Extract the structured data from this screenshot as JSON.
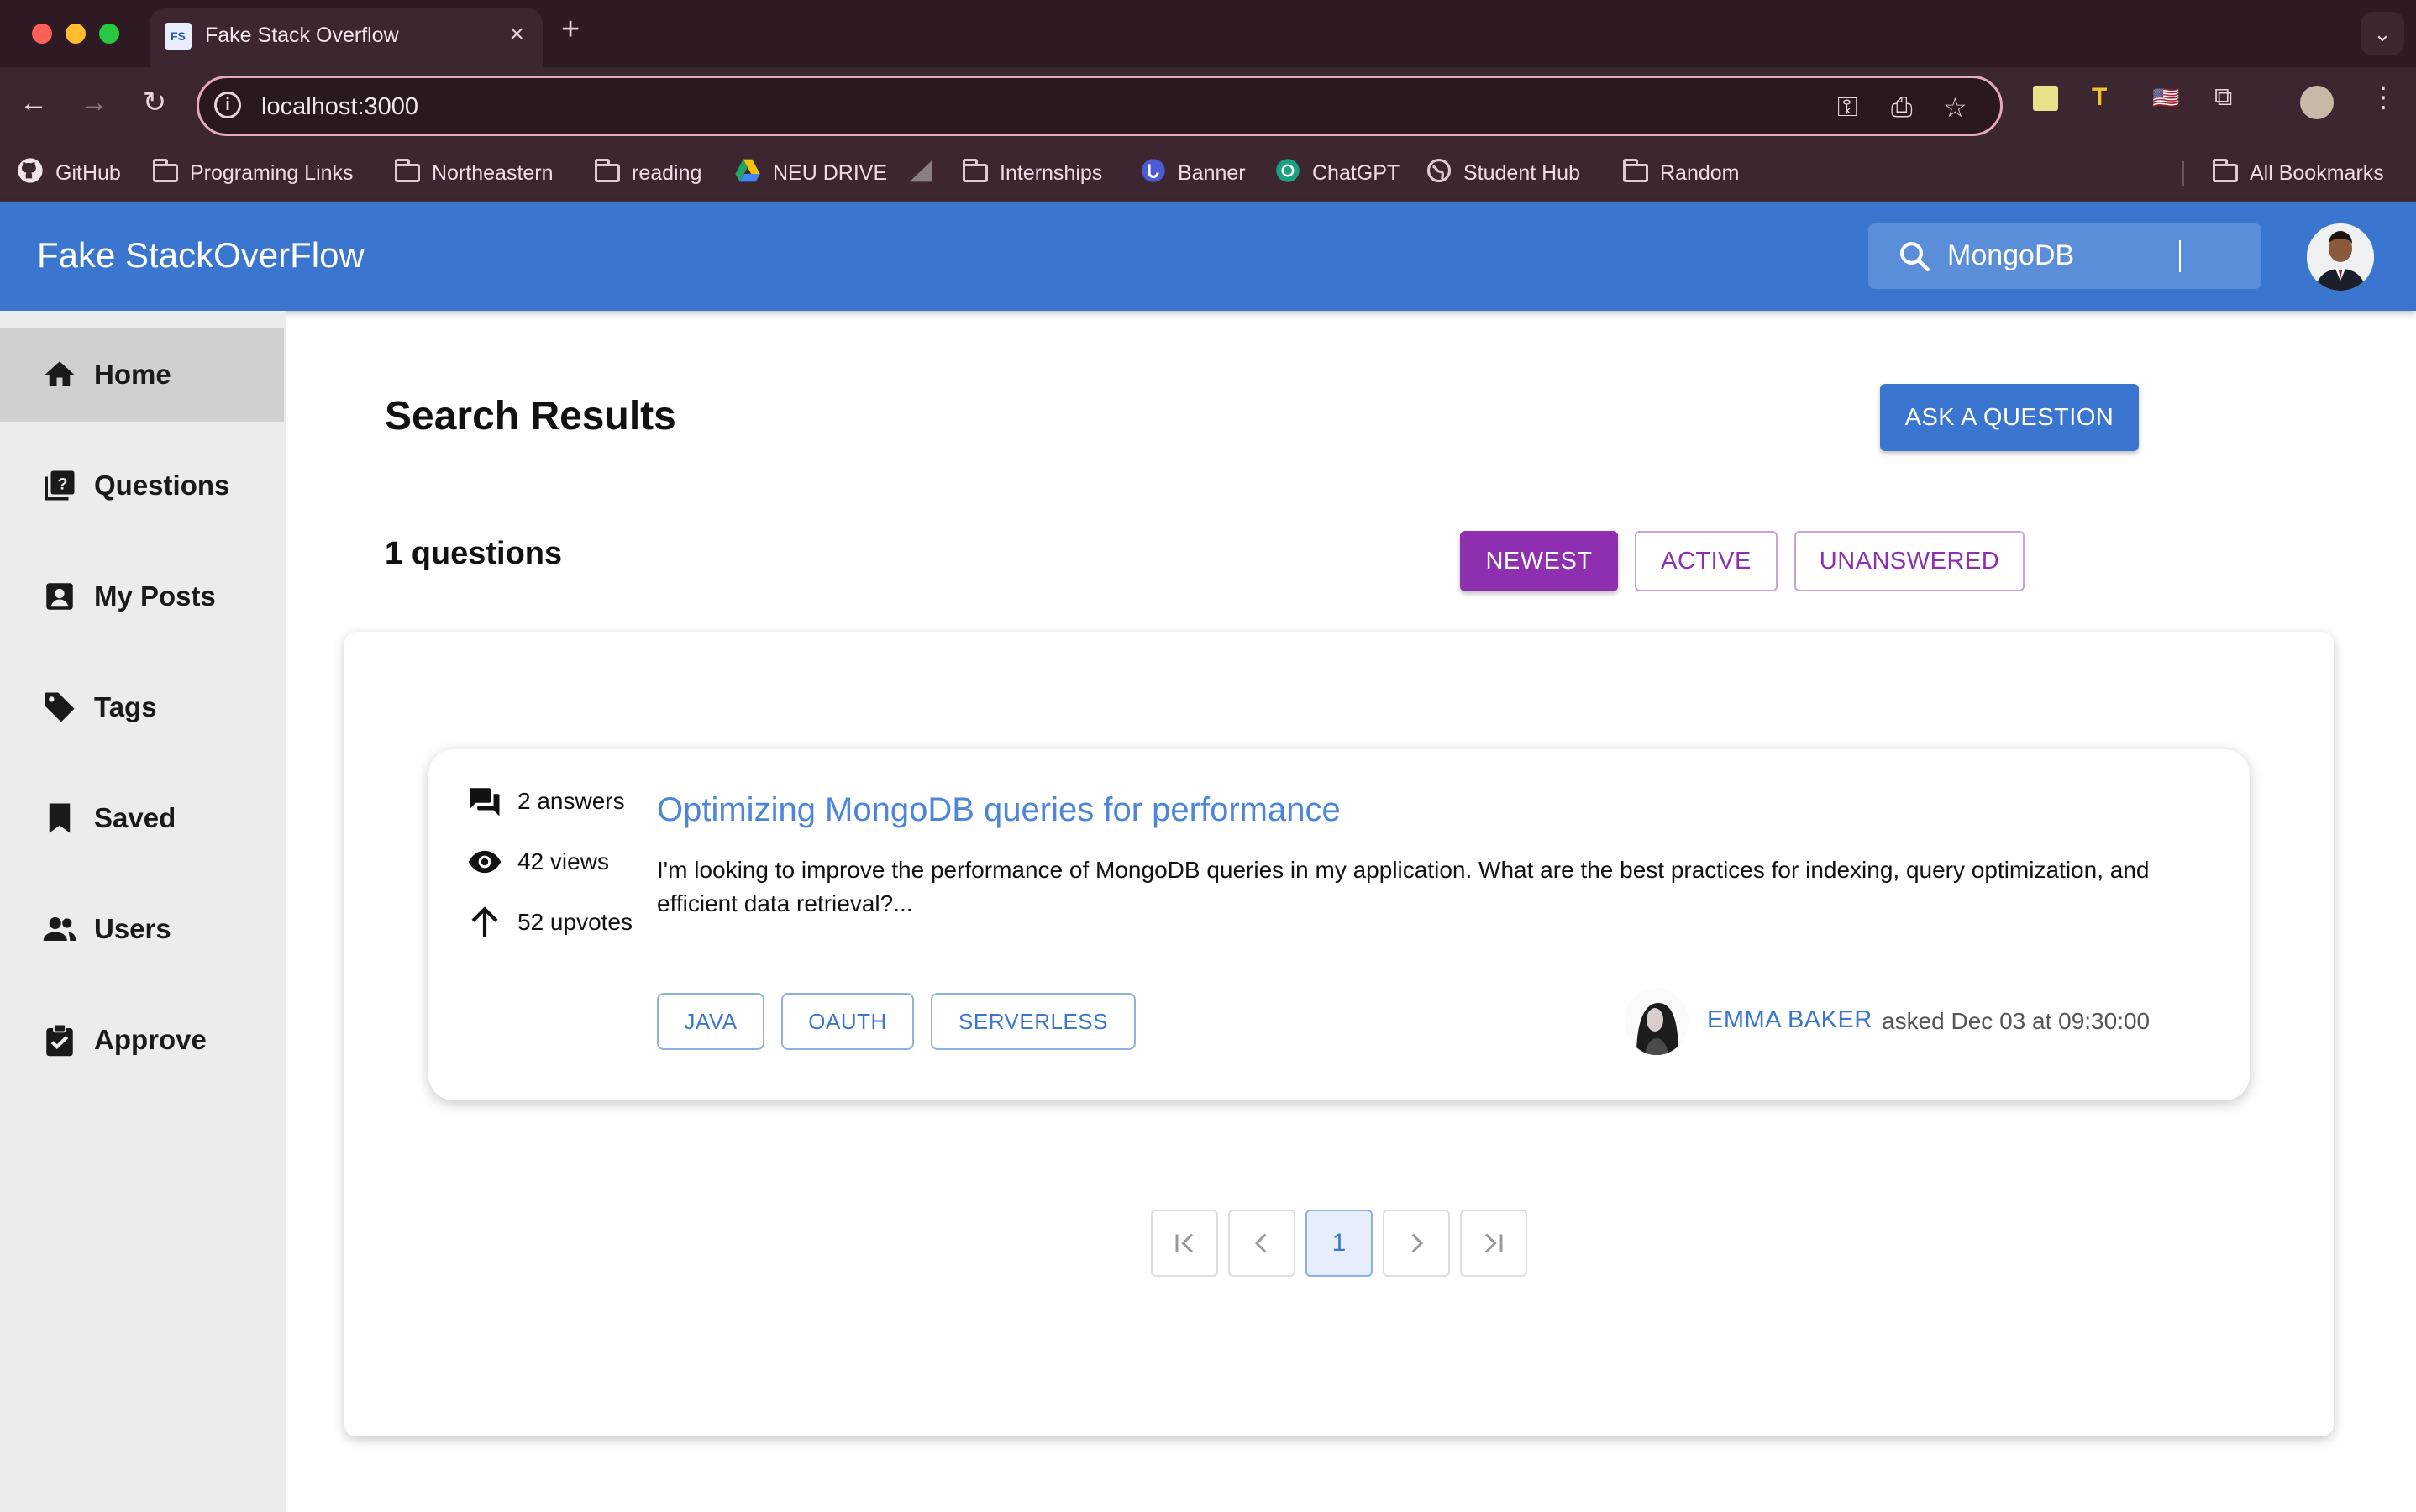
{
  "browser": {
    "tab_title": "Fake Stack Overflow",
    "tab_favicon_text": "FS",
    "url": "localhost:3000",
    "bookmarks": [
      {
        "label": "GitHub",
        "icon": "github-icon"
      },
      {
        "label": "Programing Links",
        "icon": "folder-icon"
      },
      {
        "label": "Northeastern",
        "icon": "folder-icon"
      },
      {
        "label": "reading",
        "icon": "folder-icon"
      },
      {
        "label": "NEU DRIVE",
        "icon": "google-drive-icon"
      },
      {
        "label": "",
        "icon": "chart-bookmark-icon"
      },
      {
        "label": "Internships",
        "icon": "folder-icon"
      },
      {
        "label": "Banner",
        "icon": "banner-icon"
      },
      {
        "label": "ChatGPT",
        "icon": "chatgpt-icon"
      },
      {
        "label": "Student Hub",
        "icon": "globe-icon"
      },
      {
        "label": "Random",
        "icon": "folder-icon"
      }
    ],
    "all_bookmarks": "All Bookmarks"
  },
  "header": {
    "title": "Fake StackOverFlow",
    "search_value": "MongoDB"
  },
  "sidebar": {
    "items": [
      {
        "label": "Home",
        "icon": "home-icon",
        "active": true
      },
      {
        "label": "Questions",
        "icon": "questions-icon"
      },
      {
        "label": "My Posts",
        "icon": "my-posts-icon"
      },
      {
        "label": "Tags",
        "icon": "tag-icon"
      },
      {
        "label": "Saved",
        "icon": "bookmark-icon"
      },
      {
        "label": "Users",
        "icon": "users-icon"
      },
      {
        "label": "Approve",
        "icon": "approve-icon"
      }
    ]
  },
  "main": {
    "title": "Search Results",
    "ask_button": "ASK A QUESTION",
    "count_text": "1 questions",
    "sort_buttons": [
      "NEWEST",
      "ACTIVE",
      "UNANSWERED"
    ],
    "active_sort": "NEWEST",
    "questions": [
      {
        "answers": "2 answers",
        "views": "42 views",
        "upvotes": "52 upvotes",
        "title": "Optimizing MongoDB queries for performance",
        "excerpt": "I'm looking to improve the performance of MongoDB queries in my application. What are the best practices for indexing, query optimization, and efficient data retrieval?...",
        "tags": [
          "JAVA",
          "OAUTH",
          "SERVERLESS"
        ],
        "author": "EMMA BAKER",
        "asked": "asked Dec 03 at 09:30:00"
      }
    ],
    "pagination": {
      "current_page": "1"
    }
  },
  "colors": {
    "primary": "#3a76d0",
    "sort_accent": "#8e2fb0",
    "title_link": "#4d86d9",
    "sidebar_bg": "#ececec",
    "sidebar_active": "#d0d0d0"
  }
}
